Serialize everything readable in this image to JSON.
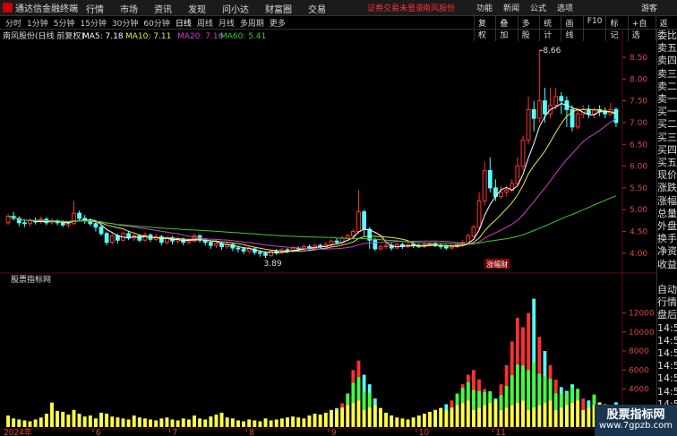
{
  "app": {
    "title": "通达信金融终端"
  },
  "menu": [
    "行情",
    "市场",
    "资讯",
    "发现",
    "问小达",
    "财富圈",
    "交易"
  ],
  "alerts": {
    "trade": "证券交易未登录",
    "stock": "南风股份"
  },
  "right_menu": [
    "功能",
    "新闻",
    "公式",
    "选项"
  ],
  "guest": "游客",
  "periods": [
    "分时",
    "1分钟",
    "5分钟",
    "15分钟",
    "30分钟",
    "60分钟",
    "日线",
    "周线",
    "月线",
    "多周期",
    "更多"
  ],
  "selected_period": "日线",
  "tools": [
    "复权",
    "叠加",
    "多股",
    "统计",
    "画线",
    "F10",
    "标记",
    "+自选",
    "返回"
  ],
  "chart_header": {
    "name": "南风股份(日线 前复权)",
    "ma5": "MA5: 7.18",
    "ma10": "MA10: 7.11",
    "ma20": "MA20: 7.16",
    "ma60": "MA60: 5.41"
  },
  "sub_panel": {
    "title": "股票指标网"
  },
  "annotations": {
    "high": "8.66",
    "low": "3.89",
    "tag": "涨幅财"
  },
  "sidebar": [
    "委比",
    "卖五",
    "卖四",
    "卖三",
    "卖二",
    "卖一",
    "买一",
    "买二",
    "买三",
    "买四",
    "买五",
    "现价",
    "涨跌",
    "涨幅",
    "总量",
    "外盘",
    "换手",
    "净资",
    "收益",
    "",
    "自动",
    "行情",
    "盘后",
    "14:50",
    "14:50",
    "14:50",
    "14:50",
    "14:50",
    "14:50",
    "14:50",
    "14:50",
    "14:50"
  ],
  "watermark": {
    "line1": "股票指标网",
    "line2": "www.7gpzb.com"
  },
  "colors": {
    "up": "#ff3333",
    "down": "#54ffff",
    "ma5": "#ffffff",
    "ma10": "#e8e84a",
    "ma20": "#d040d0",
    "ma60": "#30d030",
    "vol_yellow": "#ffff40",
    "vol_green": "#40ff40",
    "vol_red": "#ff3030"
  },
  "chart_data": {
    "type": "candlestick",
    "price_axis": {
      "ticks": [
        8.5,
        8.0,
        7.5,
        7.0,
        6.5,
        6.0,
        5.5,
        5.0,
        4.5,
        4.0
      ],
      "min": 3.75,
      "max": 8.85
    },
    "volume_axis": {
      "ticks": [
        12000,
        10000,
        8000,
        6000,
        4000,
        2000
      ]
    },
    "x_ticks": [
      "2024年",
      "6",
      "7",
      "8",
      "9",
      "10",
      "11"
    ],
    "candles": [
      [
        4.7,
        4.85,
        4.65,
        4.9
      ],
      [
        4.85,
        4.8,
        4.75,
        4.95
      ],
      [
        4.8,
        4.7,
        4.62,
        4.85
      ],
      [
        4.7,
        4.68,
        4.6,
        4.78
      ],
      [
        4.68,
        4.75,
        4.62,
        4.8
      ],
      [
        4.75,
        4.72,
        4.66,
        4.82
      ],
      [
        4.72,
        4.78,
        4.68,
        4.84
      ],
      [
        4.78,
        4.7,
        4.64,
        4.83
      ],
      [
        4.7,
        4.74,
        4.66,
        4.8
      ],
      [
        4.74,
        4.7,
        4.64,
        4.78
      ],
      [
        4.7,
        4.65,
        4.6,
        4.76
      ],
      [
        4.65,
        4.68,
        4.58,
        4.74
      ],
      [
        4.68,
        4.92,
        4.65,
        5.2
      ],
      [
        4.92,
        4.8,
        4.74,
        4.98
      ],
      [
        4.8,
        4.75,
        4.68,
        4.88
      ],
      [
        4.75,
        4.68,
        4.62,
        4.8
      ],
      [
        4.68,
        4.6,
        4.5,
        4.72
      ],
      [
        4.6,
        4.45,
        4.4,
        4.65
      ],
      [
        4.45,
        4.25,
        4.18,
        4.5
      ],
      [
        4.25,
        4.4,
        4.2,
        4.45
      ],
      [
        4.4,
        4.3,
        4.22,
        4.45
      ],
      [
        4.3,
        4.45,
        4.28,
        4.5
      ],
      [
        4.45,
        4.35,
        4.3,
        4.52
      ],
      [
        4.35,
        4.4,
        4.28,
        4.46
      ],
      [
        4.4,
        4.3,
        4.25,
        4.44
      ],
      [
        4.3,
        4.42,
        4.26,
        4.48
      ],
      [
        4.42,
        4.32,
        4.26,
        4.46
      ],
      [
        4.32,
        4.38,
        4.28,
        4.44
      ],
      [
        4.38,
        4.25,
        4.18,
        4.42
      ],
      [
        4.25,
        4.35,
        4.2,
        4.4
      ],
      [
        4.35,
        4.28,
        4.2,
        4.4
      ],
      [
        4.28,
        4.32,
        4.22,
        4.38
      ],
      [
        4.32,
        4.25,
        4.18,
        4.36
      ],
      [
        4.25,
        4.28,
        4.2,
        4.34
      ],
      [
        4.28,
        4.4,
        4.25,
        4.46
      ],
      [
        4.4,
        4.3,
        4.24,
        4.44
      ],
      [
        4.3,
        4.25,
        4.18,
        4.34
      ],
      [
        4.25,
        4.18,
        4.1,
        4.28
      ],
      [
        4.18,
        4.22,
        4.12,
        4.26
      ],
      [
        4.22,
        4.15,
        4.08,
        4.26
      ],
      [
        4.15,
        4.2,
        4.1,
        4.24
      ],
      [
        4.2,
        4.12,
        4.05,
        4.24
      ],
      [
        4.12,
        4.1,
        4.02,
        4.16
      ],
      [
        4.1,
        4.05,
        3.98,
        4.14
      ],
      [
        4.05,
        4.1,
        4.0,
        4.15
      ],
      [
        4.1,
        4.02,
        3.96,
        4.14
      ],
      [
        4.02,
        4.0,
        3.92,
        4.06
      ],
      [
        4.0,
        3.95,
        3.89,
        4.05
      ],
      [
        3.95,
        4.05,
        3.92,
        4.08
      ],
      [
        4.05,
        4.02,
        3.96,
        4.1
      ],
      [
        4.02,
        4.08,
        3.98,
        4.12
      ],
      [
        4.08,
        4.05,
        4.0,
        4.12
      ],
      [
        4.05,
        4.12,
        4.02,
        4.16
      ],
      [
        4.12,
        4.1,
        4.04,
        4.16
      ],
      [
        4.1,
        4.15,
        4.06,
        4.2
      ],
      [
        4.15,
        4.12,
        4.06,
        4.2
      ],
      [
        4.12,
        4.18,
        4.08,
        4.22
      ],
      [
        4.18,
        4.15,
        4.1,
        4.22
      ],
      [
        4.15,
        4.2,
        4.12,
        4.25
      ],
      [
        4.2,
        4.28,
        4.16,
        4.32
      ],
      [
        4.28,
        4.25,
        4.2,
        4.34
      ],
      [
        4.25,
        4.35,
        4.22,
        4.4
      ],
      [
        4.35,
        4.4,
        4.28,
        4.45
      ],
      [
        4.4,
        4.5,
        4.35,
        4.55
      ],
      [
        4.5,
        4.95,
        4.45,
        5.45
      ],
      [
        4.95,
        4.55,
        4.4,
        5.0
      ],
      [
        4.55,
        4.3,
        4.1,
        4.6
      ],
      [
        4.3,
        4.1,
        4.05,
        4.35
      ],
      [
        4.1,
        4.15,
        4.06,
        4.2
      ],
      [
        4.15,
        4.18,
        4.1,
        4.25
      ],
      [
        4.18,
        4.12,
        4.06,
        4.24
      ],
      [
        4.12,
        4.2,
        4.1,
        4.24
      ],
      [
        4.2,
        4.15,
        4.1,
        4.24
      ],
      [
        4.15,
        4.2,
        4.12,
        4.24
      ],
      [
        4.2,
        4.18,
        4.12,
        4.26
      ],
      [
        4.18,
        4.15,
        4.12,
        4.22
      ],
      [
        4.15,
        4.2,
        4.12,
        4.25
      ],
      [
        4.2,
        4.22,
        4.15,
        4.26
      ],
      [
        4.22,
        4.18,
        4.14,
        4.26
      ],
      [
        4.18,
        4.15,
        4.1,
        4.22
      ],
      [
        4.15,
        4.12,
        4.08,
        4.2
      ],
      [
        4.12,
        4.15,
        4.08,
        4.2
      ],
      [
        4.15,
        4.2,
        4.12,
        4.22
      ],
      [
        4.2,
        4.25,
        4.15,
        4.3
      ],
      [
        4.25,
        4.4,
        4.2,
        4.45
      ],
      [
        4.4,
        4.6,
        4.35,
        4.65
      ],
      [
        4.6,
        5.2,
        4.55,
        5.4
      ],
      [
        5.2,
        5.9,
        5.1,
        6.1
      ],
      [
        5.9,
        5.5,
        5.4,
        6.2
      ],
      [
        5.5,
        5.3,
        5.2,
        5.7
      ],
      [
        5.3,
        5.4,
        5.25,
        5.55
      ],
      [
        5.4,
        5.45,
        5.3,
        5.55
      ],
      [
        5.45,
        5.6,
        5.4,
        5.7
      ],
      [
        5.6,
        6.0,
        5.55,
        6.2
      ],
      [
        6.0,
        6.6,
        5.9,
        6.7
      ],
      [
        6.6,
        7.3,
        6.5,
        7.6
      ],
      [
        7.3,
        7.1,
        6.8,
        7.5
      ],
      [
        7.1,
        7.5,
        7.0,
        8.66
      ],
      [
        7.5,
        7.2,
        7.0,
        7.8
      ],
      [
        7.2,
        7.4,
        7.1,
        7.8
      ],
      [
        7.4,
        7.6,
        7.3,
        7.8
      ],
      [
        7.6,
        7.5,
        7.2,
        7.7
      ],
      [
        7.5,
        7.3,
        6.9,
        7.6
      ],
      [
        7.3,
        6.9,
        6.8,
        7.4
      ],
      [
        6.9,
        7.2,
        6.85,
        7.35
      ],
      [
        7.2,
        7.3,
        7.1,
        7.4
      ],
      [
        7.3,
        7.2,
        7.1,
        7.4
      ],
      [
        7.2,
        7.3,
        7.1,
        7.35
      ],
      [
        7.3,
        7.25,
        7.15,
        7.4
      ],
      [
        7.25,
        7.2,
        7.1,
        7.35
      ],
      [
        7.2,
        7.3,
        7.15,
        7.45
      ],
      [
        7.3,
        7.0,
        6.9,
        7.35
      ]
    ],
    "volumes": [
      1200,
      900,
      800,
      700,
      600,
      800,
      1000,
      1400,
      2600,
      1700,
      1600,
      1300,
      1800,
      1400,
      1100,
      1200,
      900,
      1500,
      1400,
      1100,
      1000,
      900,
      800,
      1200,
      1000,
      900,
      800,
      700,
      900,
      1000,
      800,
      700,
      900,
      800,
      1200,
      900,
      800,
      1100,
      1300,
      1500,
      1000,
      900,
      700,
      600,
      800,
      700,
      600,
      900,
      700,
      800,
      900,
      1000,
      1100,
      1000,
      900,
      1200,
      1400,
      1300,
      1500,
      1800,
      2000,
      2500,
      3500,
      6000,
      7000,
      5500,
      4500,
      3000,
      2000,
      1500,
      1200,
      1000,
      900,
      800,
      1000,
      1200,
      1400,
      1600,
      1800,
      2000,
      2400,
      2800,
      3500,
      4500,
      5500,
      6000,
      5000,
      4000,
      3500,
      3000,
      4500,
      6500,
      9000,
      11500,
      10500,
      12000,
      13500,
      9500,
      8000,
      6500,
      5000,
      4200,
      3800,
      4500,
      3500,
      3000,
      2800,
      3200,
      2600,
      2400,
      2200,
      2600
    ]
  }
}
